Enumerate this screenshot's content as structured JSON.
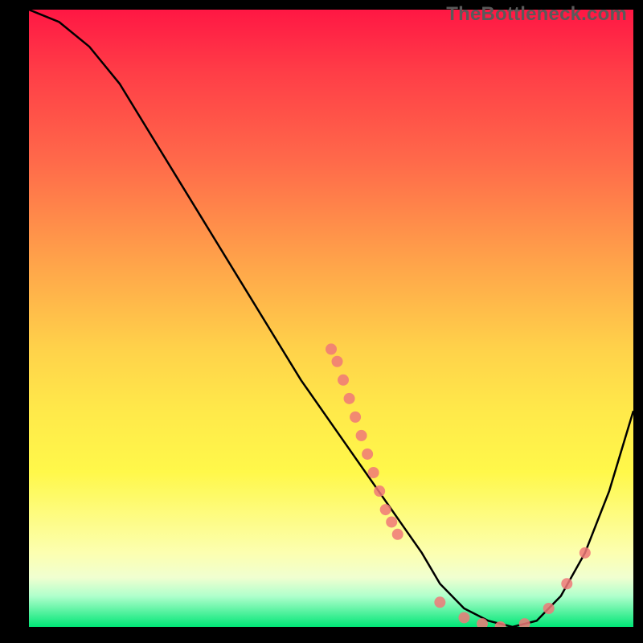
{
  "watermark": "TheBottleneck.com",
  "chart_data": {
    "type": "line",
    "title": "",
    "xlabel": "",
    "ylabel": "",
    "xlim": [
      0,
      100
    ],
    "ylim": [
      0,
      100
    ],
    "curve": {
      "name": "bottleneck-curve",
      "x": [
        0,
        5,
        10,
        15,
        20,
        25,
        30,
        35,
        40,
        45,
        50,
        55,
        60,
        65,
        68,
        72,
        76,
        80,
        84,
        88,
        92,
        96,
        100
      ],
      "y": [
        100,
        98,
        94,
        88,
        80,
        72,
        64,
        56,
        48,
        40,
        33,
        26,
        19,
        12,
        7,
        3,
        1,
        0,
        1,
        5,
        12,
        22,
        35
      ]
    },
    "points": {
      "name": "sampled-points",
      "color": "#f07878",
      "data": [
        {
          "x": 50,
          "y": 45
        },
        {
          "x": 51,
          "y": 43
        },
        {
          "x": 52,
          "y": 40
        },
        {
          "x": 53,
          "y": 37
        },
        {
          "x": 54,
          "y": 34
        },
        {
          "x": 55,
          "y": 31
        },
        {
          "x": 56,
          "y": 28
        },
        {
          "x": 57,
          "y": 25
        },
        {
          "x": 58,
          "y": 22
        },
        {
          "x": 59,
          "y": 19
        },
        {
          "x": 60,
          "y": 17
        },
        {
          "x": 61,
          "y": 15
        },
        {
          "x": 68,
          "y": 4
        },
        {
          "x": 72,
          "y": 1.5
        },
        {
          "x": 75,
          "y": 0.5
        },
        {
          "x": 78,
          "y": 0
        },
        {
          "x": 82,
          "y": 0.5
        },
        {
          "x": 86,
          "y": 3
        },
        {
          "x": 89,
          "y": 7
        },
        {
          "x": 92,
          "y": 12
        }
      ]
    }
  }
}
